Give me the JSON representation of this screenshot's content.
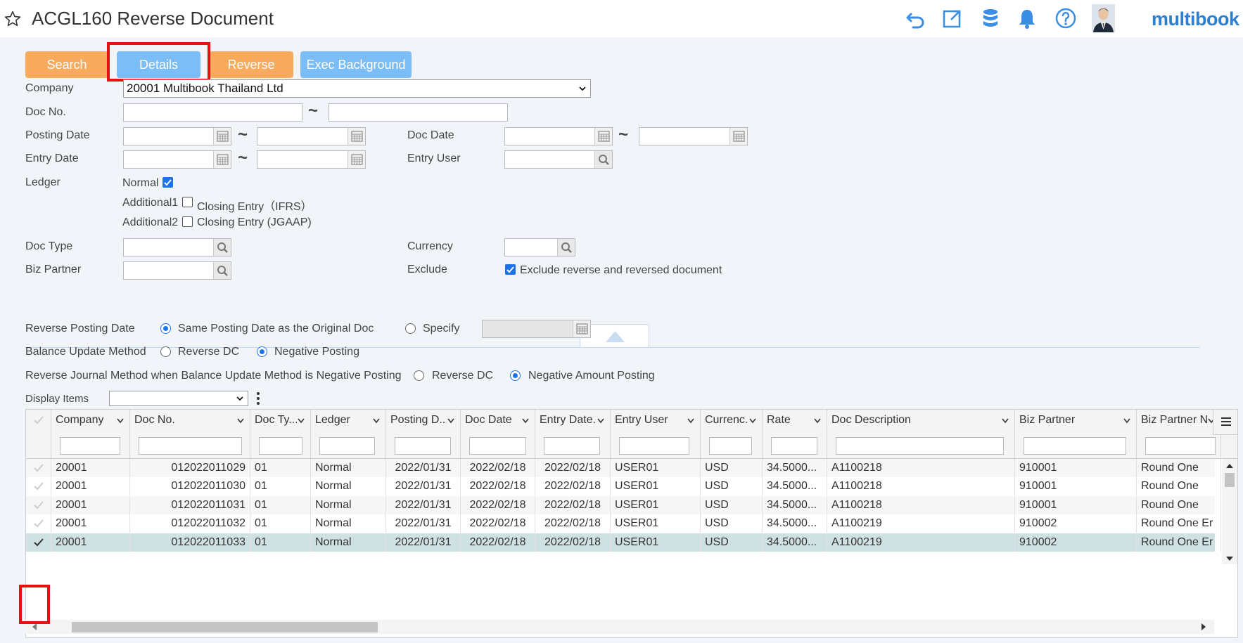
{
  "header": {
    "title": "ACGL160 Reverse Document",
    "brand": "multibook",
    "icons": [
      "star-icon",
      "undo-icon",
      "export-icon",
      "database-icon",
      "bell-icon",
      "help-icon",
      "avatar"
    ]
  },
  "toolbar": {
    "search": "Search",
    "details": "Details",
    "reverse": "Reverse",
    "exec_background": "Exec Background"
  },
  "form": {
    "company_label": "Company",
    "company_value": "20001 Multibook Thailand Ltd",
    "doc_no_label": "Doc No.",
    "posting_date_label": "Posting Date",
    "doc_date_label": "Doc Date",
    "entry_date_label": "Entry Date",
    "entry_user_label": "Entry User",
    "ledger_label": "Ledger",
    "ledger_normal": "Normal",
    "ledger_additional1": "Additional1",
    "closing_entry_ifrs": "Closing Entry（IFRS）",
    "ledger_additional2": "Additional2",
    "closing_entry_jgaap": "Closing Entry (JGAAP)",
    "doc_type_label": "Doc Type",
    "currency_label": "Currency",
    "biz_partner_label": "Biz Partner",
    "exclude_label": "Exclude",
    "exclude_option": "Exclude reverse and reversed document",
    "tilde": "~"
  },
  "options": {
    "reverse_posting_date_label": "Reverse Posting Date",
    "same_posting_date": "Same Posting Date as the Original Doc",
    "specify": "Specify",
    "balance_update_label": "Balance Update Method",
    "reverse_dc": "Reverse DC",
    "negative_posting": "Negative Posting",
    "reverse_journal_label": "Reverse Journal Method when Balance Update Method is Negative Posting",
    "reverse_dc_2": "Reverse DC",
    "negative_amount_posting": "Negative Amount Posting",
    "display_items_label": "Display Items"
  },
  "grid": {
    "columns": [
      "Company",
      "Doc No.",
      "Doc Ty...",
      "Ledger",
      "Posting D...",
      "Doc Date",
      "Entry Date...",
      "Entry User",
      "Currenc...",
      "Rate",
      "Doc Description",
      "Biz Partner",
      "Biz Partner N..."
    ],
    "rows": [
      [
        "20001",
        "012022011029",
        "01",
        "Normal",
        "2022/01/31",
        "2022/02/18",
        "2022/02/18",
        "USER01",
        "USD",
        "34.5000...",
        "A1100218",
        "910001",
        "Round One"
      ],
      [
        "20001",
        "012022011030",
        "01",
        "Normal",
        "2022/01/31",
        "2022/02/18",
        "2022/02/18",
        "USER01",
        "USD",
        "34.5000...",
        "A1100218",
        "910001",
        "Round One"
      ],
      [
        "20001",
        "012022011031",
        "01",
        "Normal",
        "2022/01/31",
        "2022/02/18",
        "2022/02/18",
        "USER01",
        "USD",
        "34.5000...",
        "A1100218",
        "910001",
        "Round One"
      ],
      [
        "20001",
        "012022011032",
        "01",
        "Normal",
        "2022/01/31",
        "2022/02/18",
        "2022/02/18",
        "USER01",
        "USD",
        "34.5000...",
        "A1100219",
        "910002",
        "Round One Er"
      ],
      [
        "20001",
        "012022011033",
        "01",
        "Normal",
        "2022/01/31",
        "2022/02/18",
        "2022/02/18",
        "USER01",
        "USD",
        "34.5000...",
        "A1100219",
        "910002",
        "Round One Er"
      ]
    ],
    "selected_row": 4
  },
  "colors": {
    "orange_button": "#f8ab5d",
    "blue_button": "#7bbdf6",
    "highlight": "#e81010",
    "brand": "#2f7fd0"
  }
}
